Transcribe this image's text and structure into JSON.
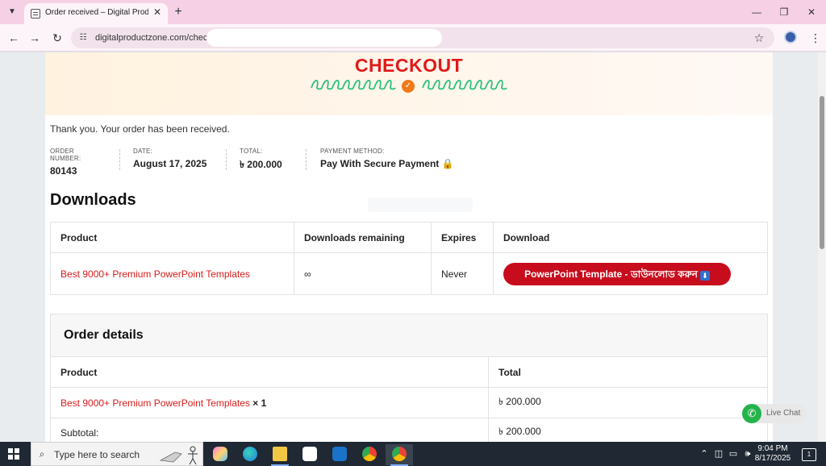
{
  "browser": {
    "tab_title": "Order received – Digital Produc",
    "url": "digitalproductzone.com/chec",
    "new_tab_glyph": "+",
    "close_glyph": "✕"
  },
  "hero": {
    "title": "CHECKOUT",
    "badge_glyph": "✓",
    "colors": {
      "title": "#e01919",
      "squiggle": "#2ec27e",
      "badge": "#f07a1a"
    }
  },
  "order": {
    "thank_you": "Thank you. Your order has been received.",
    "overview": [
      {
        "label": "ORDER NUMBER:",
        "value": "80143"
      },
      {
        "label": "DATE:",
        "value": "August 17, 2025"
      },
      {
        "label": "TOTAL:",
        "value": "৳ 200.000"
      },
      {
        "label": "PAYMENT METHOD:",
        "value": "Pay With Secure Payment 🔒"
      }
    ]
  },
  "downloads": {
    "heading": "Downloads",
    "headers": [
      "Product",
      "Downloads remaining",
      "Expires",
      "Download"
    ],
    "row": {
      "product": "Best 9000+ Premium PowerPoint Templates",
      "remaining": "∞",
      "expires": "Never",
      "button": "PowerPoint Template - ডাউনলোড করুন",
      "button_icon": "⬇"
    }
  },
  "order_details": {
    "title": "Order details",
    "headers": [
      "Product",
      "Total"
    ],
    "item": {
      "name": "Best 9000+ Premium PowerPoint Templates",
      "qty": "× 1",
      "total": "৳ 200.000"
    },
    "subtotal": {
      "label": "Subtotal:",
      "value": "৳ 200.000"
    }
  },
  "chat": {
    "label": "Live Chat"
  },
  "taskbar": {
    "search_placeholder": "Type here to search",
    "time": "9:04 PM",
    "date": "8/17/2025",
    "notification_count": "1"
  }
}
